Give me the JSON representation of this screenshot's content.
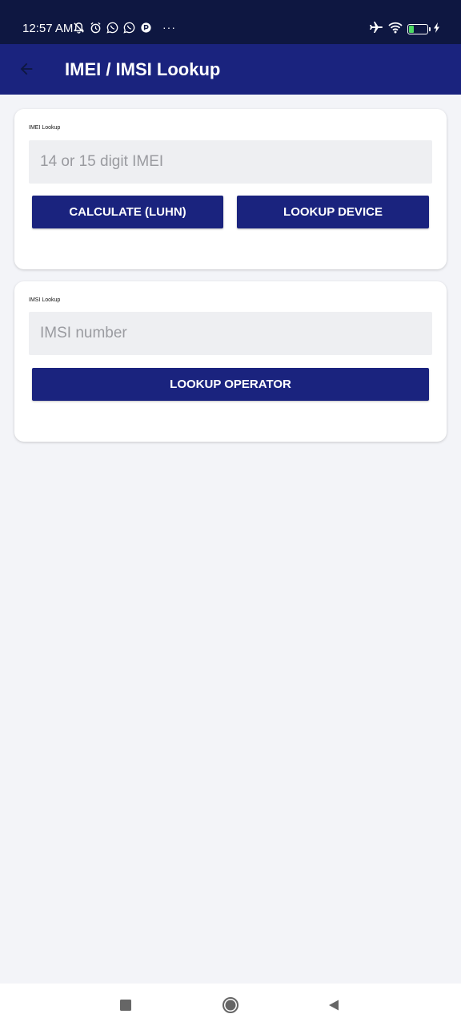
{
  "status_bar": {
    "time": "12:57 AM",
    "icons_left": [
      "bell-off-icon",
      "alarm-icon",
      "whatsapp-icon",
      "whatsapp-icon",
      "app-notification-icon"
    ],
    "more": "···",
    "icons_right": [
      "airplane-icon",
      "wifi-icon",
      "battery-icon",
      "charging-icon"
    ],
    "battery_level": "29"
  },
  "app_bar": {
    "title": "IMEI / IMSI Lookup",
    "back_icon": "arrow-back-icon",
    "color": "#1a237e"
  },
  "imei_card": {
    "label": "IMEI Lookup",
    "input_value": "",
    "input_placeholder": "14 or 15 digit IMEI",
    "calculate_button": "CALCULATE (LUHN)",
    "lookup_button": "LOOKUP DEVICE"
  },
  "imsi_card": {
    "label": "IMSI Lookup",
    "input_value": "",
    "input_placeholder": "IMSI number",
    "lookup_button": "LOOKUP OPERATOR"
  },
  "nav_bar": {
    "icons": [
      "recents-square-icon",
      "home-circle-icon",
      "back-triangle-icon"
    ]
  },
  "colors": {
    "status_bar_bg": "#0e1741",
    "primary": "#1a237e",
    "page_bg": "#f3f4f8",
    "field_bg": "#eeeff2"
  }
}
